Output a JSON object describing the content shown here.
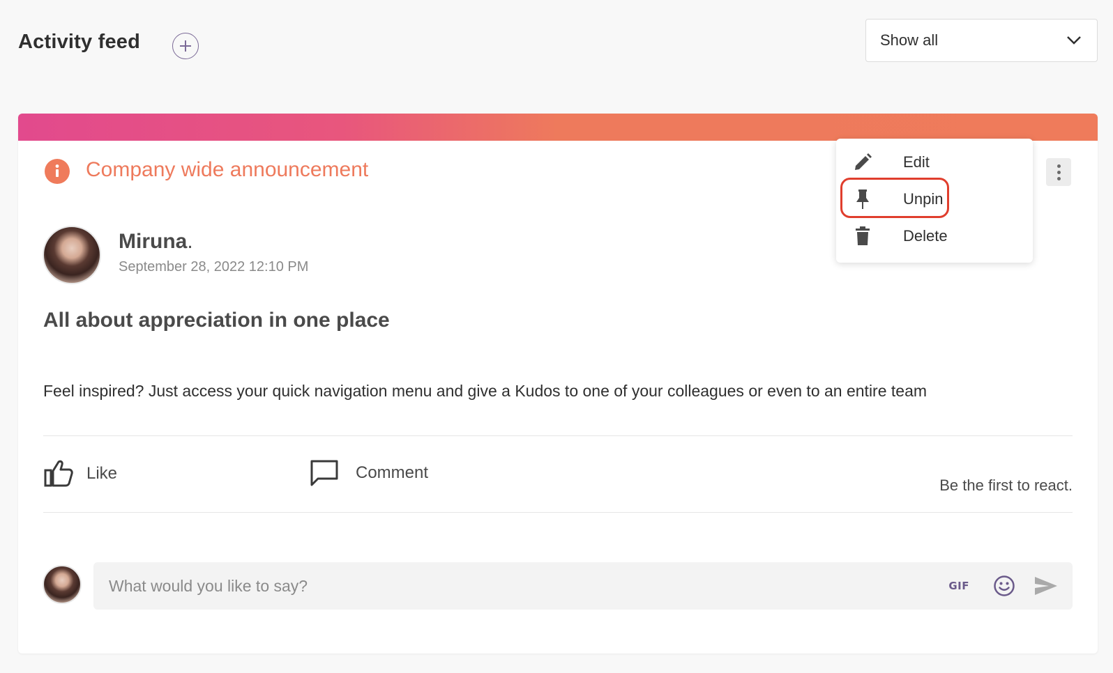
{
  "header": {
    "title": "Activity feed",
    "add_icon": "plus-circle-icon",
    "filter": {
      "selected": "Show all",
      "icon": "chevron-down-icon"
    }
  },
  "post": {
    "banner_colors": [
      "#e24a8d",
      "#ee7a5c"
    ],
    "category": {
      "icon": "info-icon",
      "label": "Company wide announcement",
      "color": "#ef7b5b"
    },
    "author": {
      "name": "Miruna",
      "suffix": ".",
      "date": "September 28, 2022 12:10 PM",
      "avatar": "avatar-photo"
    },
    "title": "All about appreciation in one place",
    "body": "Feel inspired? Just access your quick navigation menu and give a Kudos to one of your colleagues or even to an entire team",
    "actions": {
      "like": {
        "label": "Like",
        "icon": "thumbs-up-icon"
      },
      "comment": {
        "label": "Comment",
        "icon": "comment-icon"
      },
      "reactions_text": "Be the first to react."
    },
    "comment_box": {
      "placeholder": "What would you like to say?",
      "gif_label": "GIF",
      "emoji_icon": "emoji-icon",
      "send_icon": "send-icon"
    },
    "more_icon": "more-vertical-icon"
  },
  "context_menu": {
    "items": [
      {
        "label": "Edit",
        "icon": "pencil-icon"
      },
      {
        "label": "Unpin",
        "icon": "pin-icon",
        "highlighted": true
      },
      {
        "label": "Delete",
        "icon": "trash-icon"
      }
    ],
    "highlight_color": "#e03e2d"
  }
}
